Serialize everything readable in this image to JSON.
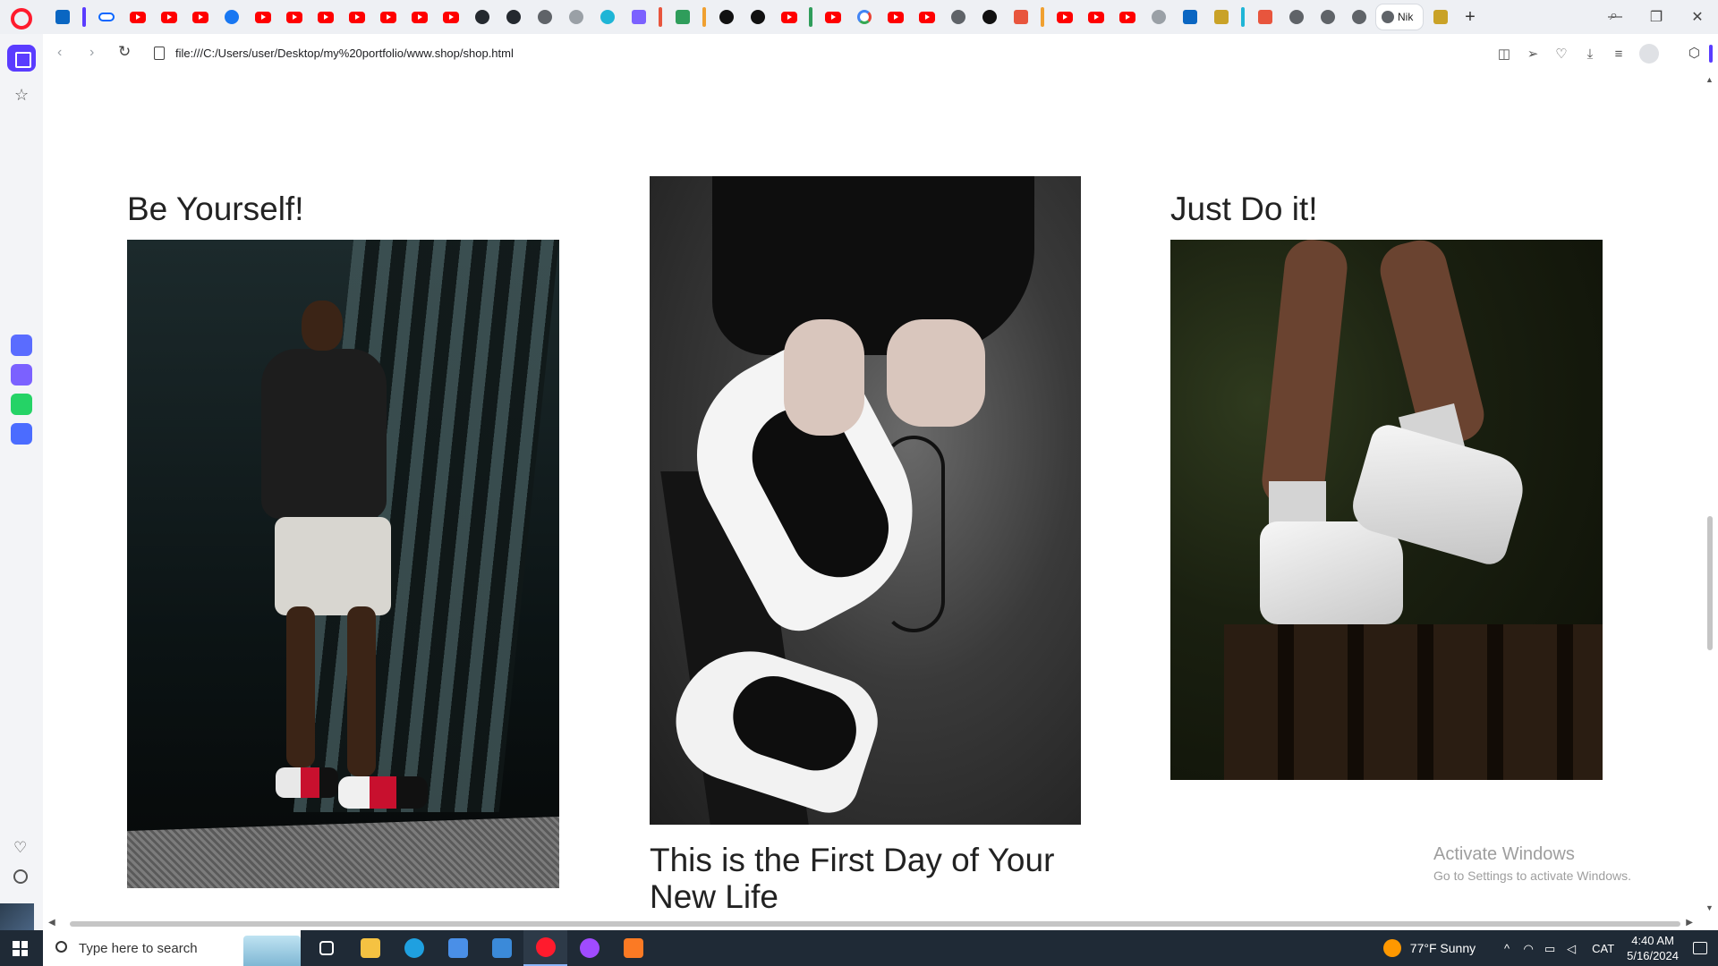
{
  "browser": {
    "active_tab_title": "Nik",
    "url": "file:///C:/Users/user/Desktop/my%20portfolio/www.shop/shop.html",
    "new_tab_symbol": "+",
    "tabs": [
      {
        "icon": "google-translate-icon",
        "color": "#4285f4"
      },
      {
        "icon": "accent-bar",
        "color": "#5a3cff"
      },
      {
        "icon": "meta-icon",
        "color": "#0866ff"
      },
      {
        "icon": "youtube-icon",
        "color": "#ff0000"
      },
      {
        "icon": "youtube-icon",
        "color": "#ff0000"
      },
      {
        "icon": "youtube-icon",
        "color": "#ff0000"
      },
      {
        "icon": "facebook-icon",
        "color": "#1877f2"
      },
      {
        "icon": "youtube-icon",
        "color": "#ff0000"
      },
      {
        "icon": "youtube-icon",
        "color": "#ff0000"
      },
      {
        "icon": "youtube-icon",
        "color": "#ff0000"
      },
      {
        "icon": "youtube-icon",
        "color": "#ff0000"
      },
      {
        "icon": "youtube-icon",
        "color": "#ff0000"
      },
      {
        "icon": "youtube-icon",
        "color": "#ff0000"
      },
      {
        "icon": "youtube-icon",
        "color": "#ff0000"
      },
      {
        "icon": "github-icon",
        "color": "#24292f"
      },
      {
        "icon": "github-icon",
        "color": "#24292f"
      },
      {
        "icon": "globe-icon",
        "color": "#9aa0a6"
      },
      {
        "icon": "page-icon",
        "color": "#5f6368"
      },
      {
        "icon": "teal-app-icon",
        "color": "#1fb5d6"
      },
      {
        "icon": "copilot-icon",
        "color": "#7b61ff"
      },
      {
        "icon": "accent-bar",
        "color": "#e8553d"
      },
      {
        "icon": "green-app-icon",
        "color": "#2f9d5b"
      },
      {
        "icon": "accent-bar",
        "color": "#f0a030"
      },
      {
        "icon": "chatgpt-icon",
        "color": "#111111"
      },
      {
        "icon": "chatgpt-icon",
        "color": "#111111"
      },
      {
        "icon": "youtube-icon",
        "color": "#ff0000"
      },
      {
        "icon": "accent-bar",
        "color": "#2f9d5b"
      },
      {
        "icon": "youtube-icon",
        "color": "#ff0000"
      },
      {
        "icon": "google-icon",
        "color": "#4285f4"
      },
      {
        "icon": "youtube-icon",
        "color": "#ff0000"
      },
      {
        "icon": "youtube-icon",
        "color": "#ff0000"
      },
      {
        "icon": "globe-icon",
        "color": "#5f6368"
      },
      {
        "icon": "dark-app-icon",
        "color": "#111111"
      },
      {
        "icon": "red-app-icon",
        "color": "#e8553d"
      },
      {
        "icon": "accent-bar",
        "color": "#f0a030"
      },
      {
        "icon": "youtube-icon",
        "color": "#ff0000"
      },
      {
        "icon": "youtube-icon",
        "color": "#ff0000"
      },
      {
        "icon": "youtube-icon",
        "color": "#ff0000"
      },
      {
        "icon": "speaker-icon",
        "color": "#5f6368"
      },
      {
        "icon": "linkedin-icon",
        "color": "#0a66c2"
      },
      {
        "icon": "vuetify-icon",
        "color": "#c9a227"
      },
      {
        "icon": "accent-bar",
        "color": "#1fb5d6"
      },
      {
        "icon": "red-app-icon",
        "color": "#e8553d"
      },
      {
        "icon": "globe-icon",
        "color": "#5f6368"
      },
      {
        "icon": "globe-icon",
        "color": "#5f6368"
      },
      {
        "icon": "globe-icon",
        "color": "#5f6368"
      }
    ],
    "trailing_tab_icon": "chart-app-icon",
    "window_controls": [
      "search-icon",
      "minimize-icon",
      "restore-icon",
      "close-icon"
    ],
    "accent": "#5a3cff"
  },
  "sidebar": {
    "apps": [
      {
        "name": "app-store-icon",
        "color": "#5a6cff"
      },
      {
        "name": "messenger-icon",
        "color": "#7b61ff"
      },
      {
        "name": "whatsapp-icon",
        "color": "#25d366"
      },
      {
        "name": "music-icon",
        "color": "#4b6cff"
      }
    ]
  },
  "page": {
    "columns": [
      {
        "heading": "Be Yourself!",
        "photo": "man-standing-in-sneakers"
      },
      {
        "heading": "",
        "photo": "hands-lacing-black-white-sneaker",
        "caption": "This is the First Day of Your New Life"
      },
      {
        "heading": "Just Do it!",
        "photo": "legs-in-white-high-top-sneakers"
      }
    ]
  },
  "watermark": {
    "title": "Activate Windows",
    "subtitle": "Go to Settings to activate Windows."
  },
  "taskbar": {
    "search_placeholder": "Type here to search",
    "apps": [
      {
        "name": "task-view-icon",
        "color": "#ffffff"
      },
      {
        "name": "file-explorer-icon",
        "color": "#f5c242"
      },
      {
        "name": "edge-icon",
        "color": "#1fa0e0"
      },
      {
        "name": "store-icon",
        "color": "#4a8fe7"
      },
      {
        "name": "mail-icon",
        "color": "#3b8ad9"
      },
      {
        "name": "opera-icon",
        "color": "#ff1b2d"
      },
      {
        "name": "messenger-icon",
        "color": "#a04bff"
      },
      {
        "name": "xampp-icon",
        "color": "#fb7a24"
      }
    ],
    "weather": "77°F  Sunny",
    "language": "CAT",
    "time": "4:40 AM",
    "date": "5/16/2024"
  }
}
